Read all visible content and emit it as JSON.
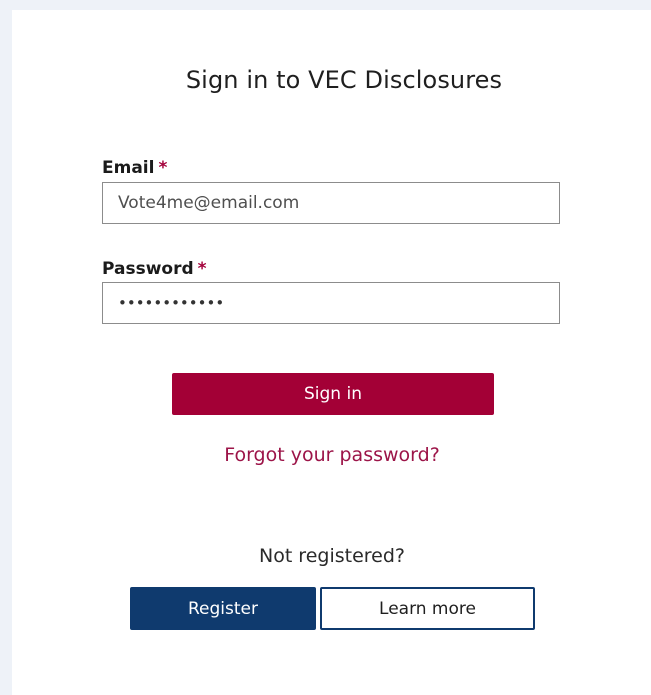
{
  "page": {
    "title": "Sign in to VEC Disclosures"
  },
  "form": {
    "email": {
      "label": "Email",
      "required_mark": "*",
      "value": "Vote4me@email.com"
    },
    "password": {
      "label": "Password",
      "required_mark": "*",
      "value": "••••••••••••"
    },
    "signin_label": "Sign in",
    "forgot_label": "Forgot your password?"
  },
  "register": {
    "prompt": "Not registered?",
    "register_label": "Register",
    "learn_more_label": "Learn more"
  },
  "colors": {
    "primary": "#a30036",
    "secondary": "#0f3a6e",
    "background": "#eef2f8"
  }
}
